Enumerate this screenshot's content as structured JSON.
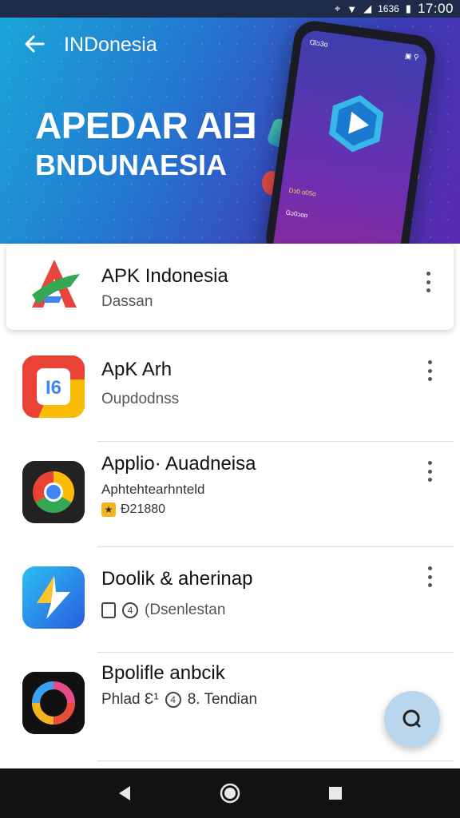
{
  "status_bar": {
    "time": "17:00",
    "network": "1636"
  },
  "header": {
    "title": "INDonesia",
    "headline_line1": "APEDAR AIƎ",
    "headline_line2": "BNDUNAESIA"
  },
  "phone_mock": {
    "screen_top": "Ɑlɔ3ɑ",
    "screen_line1": "Dɔ0 ɑ05ɑ",
    "screen_line2": "Gɔ0ɔɑɑ"
  },
  "apps": [
    {
      "title": "APK Indonesia",
      "subtitle": "Dassan",
      "icon": "apk-indonesia-logo-icon"
    },
    {
      "title": "ApK Arh",
      "subtitle": "Oupdodnss",
      "icon": "apk-arh-logo-icon"
    },
    {
      "title": "Applio· Auadneisa",
      "subtitle": "Aphtehtearhnteld",
      "extra": "Ð21880",
      "icon": "chrome-icon"
    },
    {
      "title": "Doolik & aherinap",
      "subtitle": "(Dsenlestan",
      "icon": "blue-arrow-logo-icon"
    },
    {
      "title": "Bpolifle anbcik",
      "subtitle": "Phlad Ɛ¹",
      "extra": "8. Tendian",
      "icon": "ring-logo-icon"
    }
  ],
  "icons": {
    "back": "back-arrow-icon",
    "more": "more-vertical-icon",
    "fab": "search-icon",
    "nav_back": "triangle-back-icon",
    "nav_home": "circle-home-icon",
    "nav_recents": "square-recents-icon"
  },
  "colors": {
    "hero_start": "#1aa6d8",
    "hero_end": "#5a2ab0",
    "fab": "#b9d6ec",
    "nav_bar": "#121212",
    "badge": "#f2b521"
  }
}
